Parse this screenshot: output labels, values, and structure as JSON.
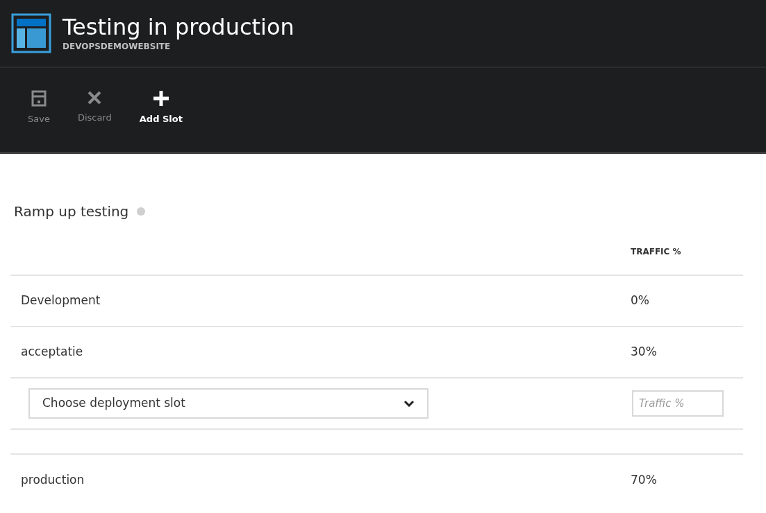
{
  "header": {
    "title": "Testing in production",
    "subtitle": "DEVOPSDEMOWEBSITE"
  },
  "toolbar": [
    {
      "kind": "save",
      "label": "Save",
      "disabled": true
    },
    {
      "kind": "discard",
      "label": "Discard",
      "disabled": true
    },
    {
      "kind": "add",
      "label": "Add Slot",
      "disabled": false
    }
  ],
  "section": {
    "title": "Ramp up testing"
  },
  "table": {
    "columns": [
      "TRAFFIC %"
    ],
    "rows": [
      {
        "kind": "slot",
        "name": "Development",
        "traffic": "0%"
      },
      {
        "kind": "slot",
        "name": "acceptatie",
        "traffic": "30%"
      },
      {
        "kind": "new",
        "select_placeholder": "Choose deployment slot",
        "traffic_placeholder": "Traffic %"
      },
      {
        "kind": "spacer"
      },
      {
        "kind": "slot",
        "name": "production",
        "traffic": "70%"
      }
    ]
  }
}
